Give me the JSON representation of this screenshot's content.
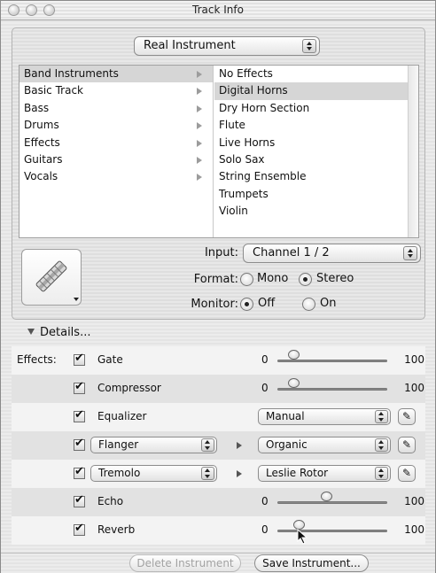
{
  "window": {
    "title": "Track Info"
  },
  "instrument_type": {
    "selected": "Real Instrument"
  },
  "categories": [
    "Band Instruments",
    "Basic Track",
    "Bass",
    "Drums",
    "Effects",
    "Guitars",
    "Vocals"
  ],
  "categories_selected_index": 0,
  "presets": [
    "No Effects",
    "Digital Horns",
    "Dry Horn Section",
    "Flute",
    "Live Horns",
    "Solo Sax",
    "String Ensemble",
    "Trumpets",
    "Violin"
  ],
  "presets_selected_index": 1,
  "input": {
    "label": "Input:",
    "value": "Channel 1 / 2"
  },
  "format": {
    "label": "Format:",
    "options": [
      "Mono",
      "Stereo"
    ],
    "selected": "Stereo"
  },
  "monitor": {
    "label": "Monitor:",
    "options": [
      "Off",
      "On"
    ],
    "selected": "Off"
  },
  "details": {
    "label": "Details..."
  },
  "effects": {
    "label": "Effects:",
    "gate": {
      "name": "Gate",
      "checked": true,
      "min": "0",
      "max": "100",
      "level": 0.15
    },
    "compressor": {
      "name": "Compressor",
      "checked": true,
      "min": "0",
      "max": "100",
      "level": 0.15
    },
    "equalizer": {
      "name": "Equalizer",
      "checked": true,
      "preset": "Manual"
    },
    "flanger": {
      "name": "Flanger",
      "checked": true,
      "preset": "Organic"
    },
    "tremolo": {
      "name": "Tremolo",
      "checked": true,
      "preset": "Leslie Rotor"
    },
    "echo": {
      "name": "Echo",
      "checked": true,
      "min": "0",
      "max": "100",
      "level": 0.45
    },
    "reverb": {
      "name": "Reverb",
      "checked": true,
      "min": "0",
      "max": "100",
      "level": 0.2
    }
  },
  "buttons": {
    "delete": "Delete Instrument",
    "save": "Save Instrument..."
  }
}
